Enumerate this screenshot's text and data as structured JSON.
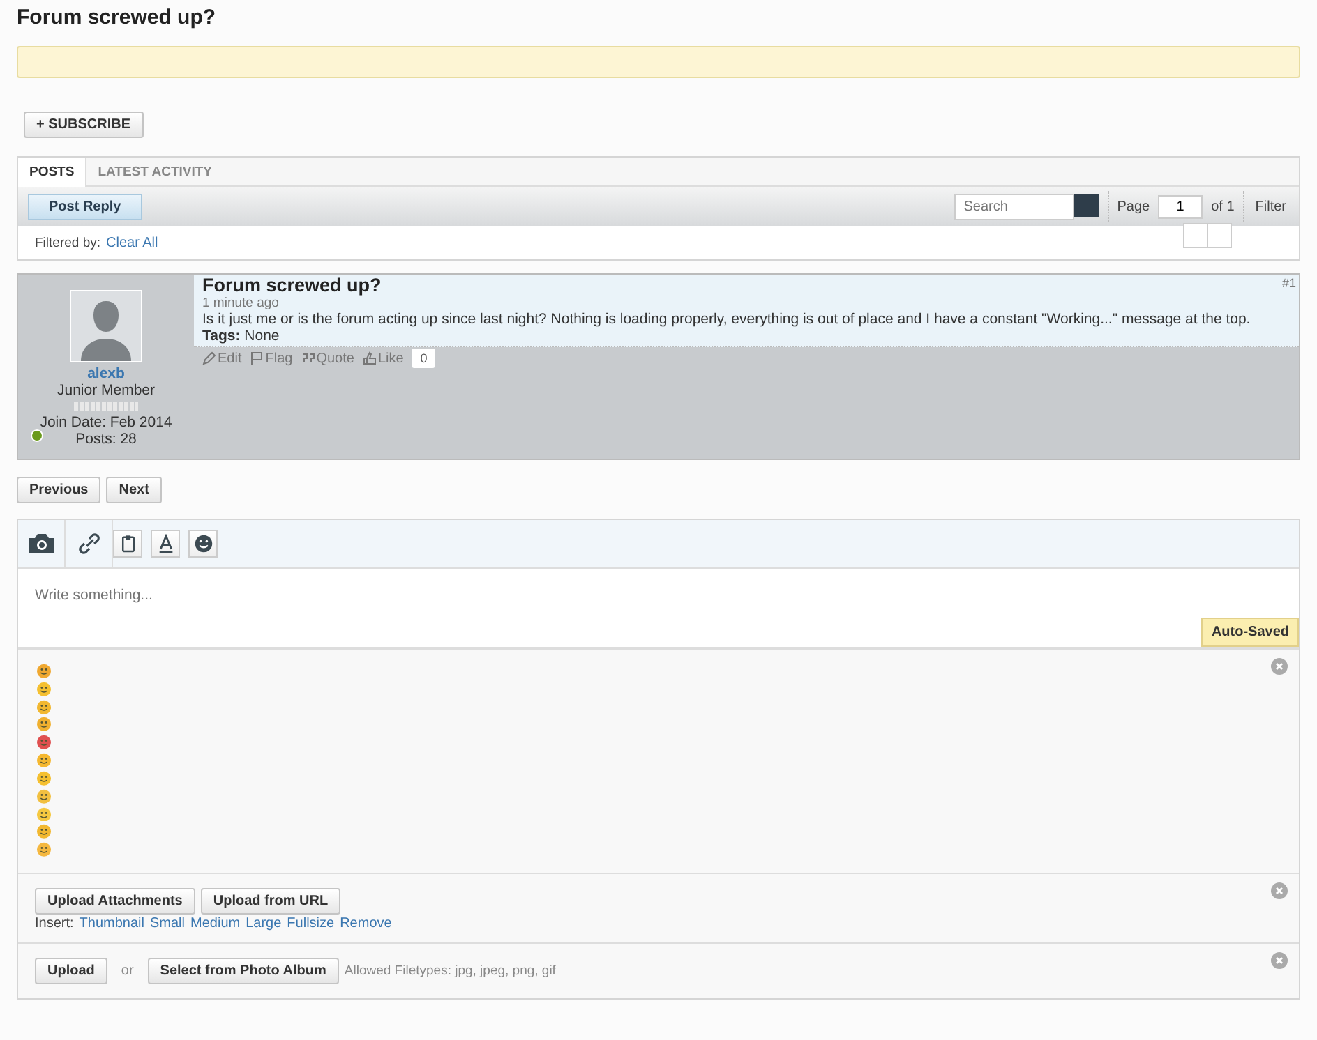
{
  "page_title": "Forum screwed up?",
  "subscribe_button": {
    "icon": "+",
    "label": "SUBSCRIBE"
  },
  "tabs": [
    {
      "label": "POSTS",
      "selected": true
    },
    {
      "label": "LATEST ACTIVITY",
      "selected": false
    }
  ],
  "toolbar": {
    "post_reply": "Post Reply",
    "search": {
      "placeholder": "Search"
    },
    "page_label": "Page",
    "page_value": "1",
    "page_of": "of 1",
    "filter": "Filter"
  },
  "filter_bar": {
    "label": "Filtered by:",
    "clear": "Clear All"
  },
  "post": {
    "number": "#1",
    "title": "Forum screwed up?",
    "time": "1 minute ago",
    "body": "Is it just me or is the forum acting up since last night? Nothing is loading properly, everything is out of place and I have a constant \"Working...\" message at the top.",
    "tags_label": "Tags:",
    "tags": "None",
    "actions": [
      {
        "kind": "edit",
        "label": "Edit"
      },
      {
        "kind": "flag",
        "label": "Flag"
      },
      {
        "kind": "quote",
        "label": "Quote"
      },
      {
        "kind": "like",
        "label": "Like"
      }
    ],
    "like_count": "0",
    "author": {
      "name": "alexb",
      "rank": "Junior Member",
      "join_date": "Join Date: Feb 2014",
      "posts": "Posts: 28",
      "online": true
    }
  },
  "pager": [
    "Previous",
    "Next"
  ],
  "editor": {
    "tools": [
      {
        "kind": "camera",
        "selected": true
      },
      {
        "kind": "link",
        "selected": true
      },
      {
        "kind": "clipboard",
        "selected": false
      },
      {
        "kind": "font",
        "selected": false
      },
      {
        "kind": "smiley",
        "selected": false
      }
    ],
    "placeholder": "Write something...",
    "autosave": "Auto-Saved",
    "smilies": [
      {
        "color": "#f0a830"
      },
      {
        "color": "#f5c030"
      },
      {
        "color": "#f2b830"
      },
      {
        "color": "#f0b030"
      },
      {
        "color": "#e05050"
      },
      {
        "color": "#f5b830"
      },
      {
        "color": "#f5c030"
      },
      {
        "color": "#f2c040"
      },
      {
        "color": "#f5c840"
      },
      {
        "color": "#f2b830"
      },
      {
        "color": "#f5b840"
      }
    ],
    "attach_buttons": [
      "Upload Attachments",
      "Upload from URL"
    ],
    "insert_label": "Insert:",
    "insert_links": [
      "Thumbnail",
      "Small",
      "Medium",
      "Large",
      "Fullsize",
      "Remove"
    ],
    "upload_button": "Upload",
    "or": "or",
    "album_button": "Select from Photo Album",
    "filetypes": "Allowed Filetypes: jpg, jpeg, png, gif"
  }
}
